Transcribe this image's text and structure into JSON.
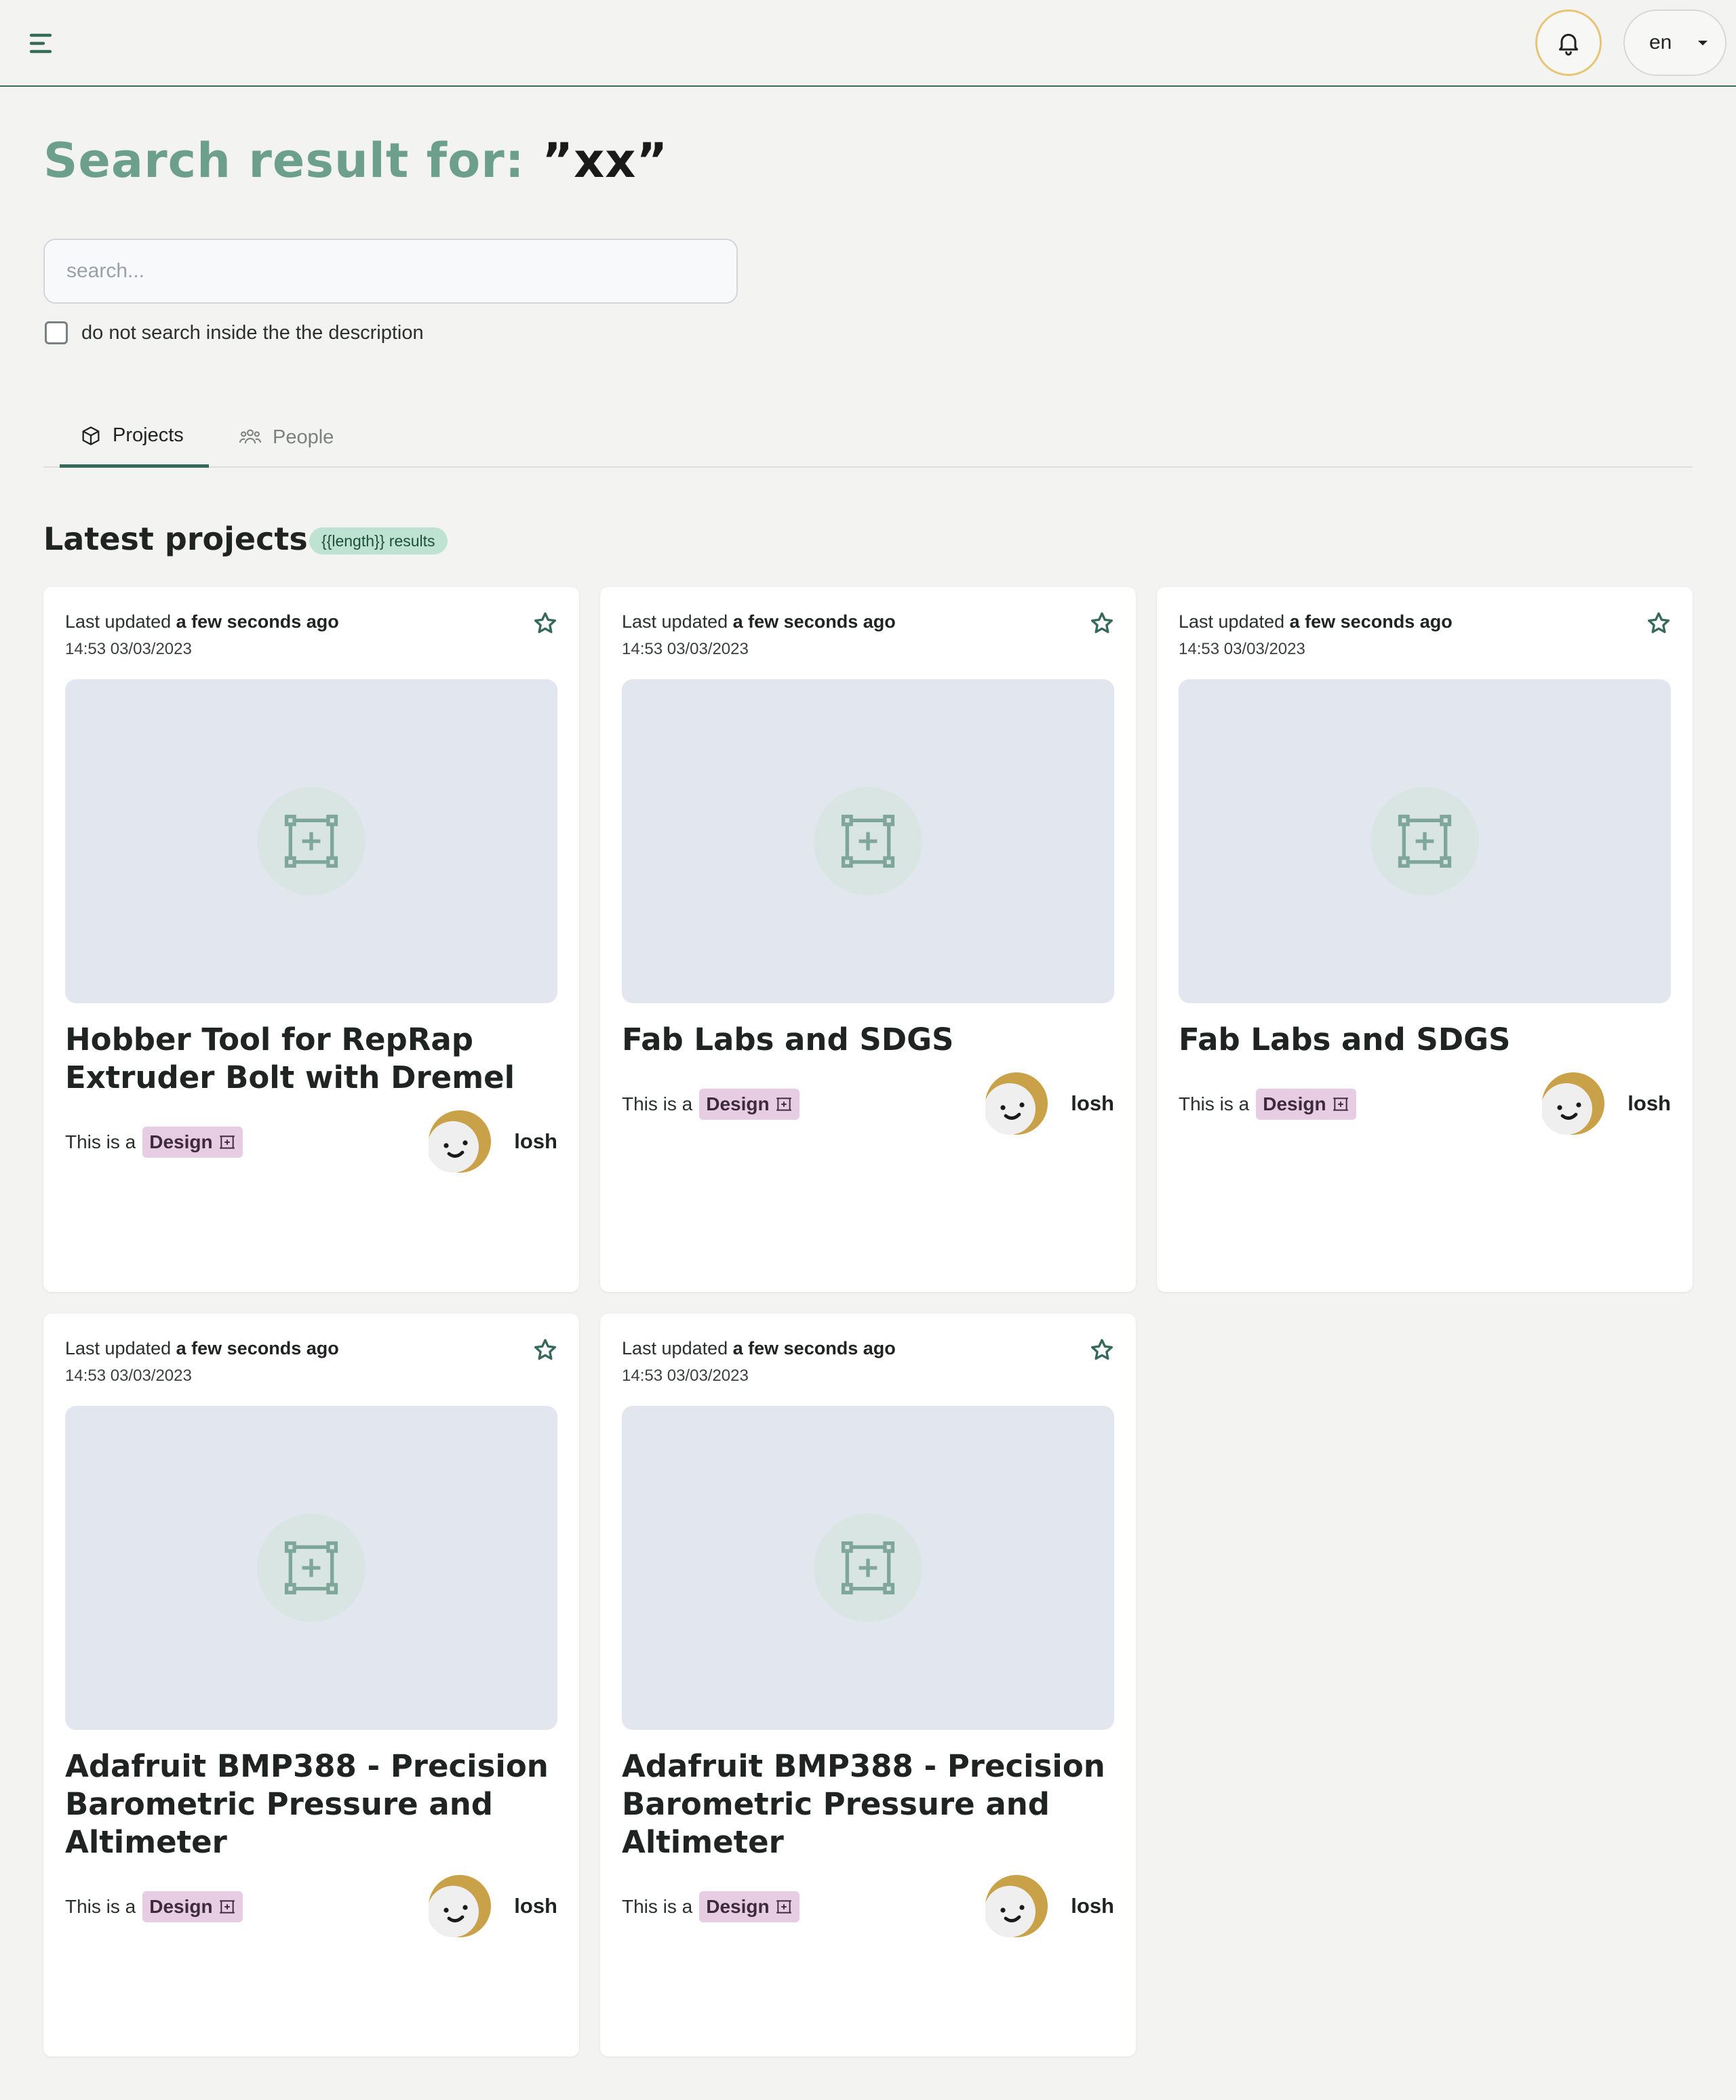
{
  "header": {
    "menu_icon": "menu-icon",
    "bell_icon": "bell-icon",
    "language": "en"
  },
  "title": {
    "prefix": "Search result for: ",
    "query": "”xx”"
  },
  "search": {
    "placeholder": "search...",
    "value": "",
    "checkbox_label": "do not search inside the the description",
    "checkbox_checked": false
  },
  "tabs": [
    {
      "label": "Projects",
      "icon": "cube-icon",
      "active": true
    },
    {
      "label": "People",
      "icon": "users-icon",
      "active": false
    }
  ],
  "section": {
    "title": "Latest projects",
    "badge": "{{length}} results"
  },
  "colors": {
    "accent": "#35695a",
    "title_prefix": "#6da08c",
    "badge_bg": "#bfe3d2",
    "design_badge_bg": "#e7cde4",
    "bell_ring": "#e7c576"
  },
  "cards": [
    {
      "updated_prefix": "Last updated ",
      "updated_rel": "a few seconds ago",
      "datetime": "14:53 03/03/2023",
      "title": "Hobber Tool for RepRap Extruder Bolt with Dremel",
      "type_prefix": "This is a",
      "type": "Design",
      "owner": "losh"
    },
    {
      "updated_prefix": "Last updated ",
      "updated_rel": "a few seconds ago",
      "datetime": "14:53 03/03/2023",
      "title": "Fab Labs and SDGS",
      "type_prefix": "This is a",
      "type": "Design",
      "owner": "losh"
    },
    {
      "updated_prefix": "Last updated ",
      "updated_rel": "a few seconds ago",
      "datetime": "14:53 03/03/2023",
      "title": "Fab Labs and SDGS",
      "type_prefix": "This is a",
      "type": "Design",
      "owner": "losh"
    },
    {
      "updated_prefix": "Last updated ",
      "updated_rel": "a few seconds ago",
      "datetime": "14:53 03/03/2023",
      "title": "Adafruit BMP388 - Precision Barometric Pressure and Altimeter",
      "type_prefix": "This is a",
      "type": "Design",
      "owner": "losh"
    },
    {
      "updated_prefix": "Last updated ",
      "updated_rel": "a few seconds ago",
      "datetime": "14:53 03/03/2023",
      "title": "Adafruit BMP388 - Precision Barometric Pressure and Altimeter",
      "type_prefix": "This is a",
      "type": "Design",
      "owner": "losh"
    }
  ]
}
